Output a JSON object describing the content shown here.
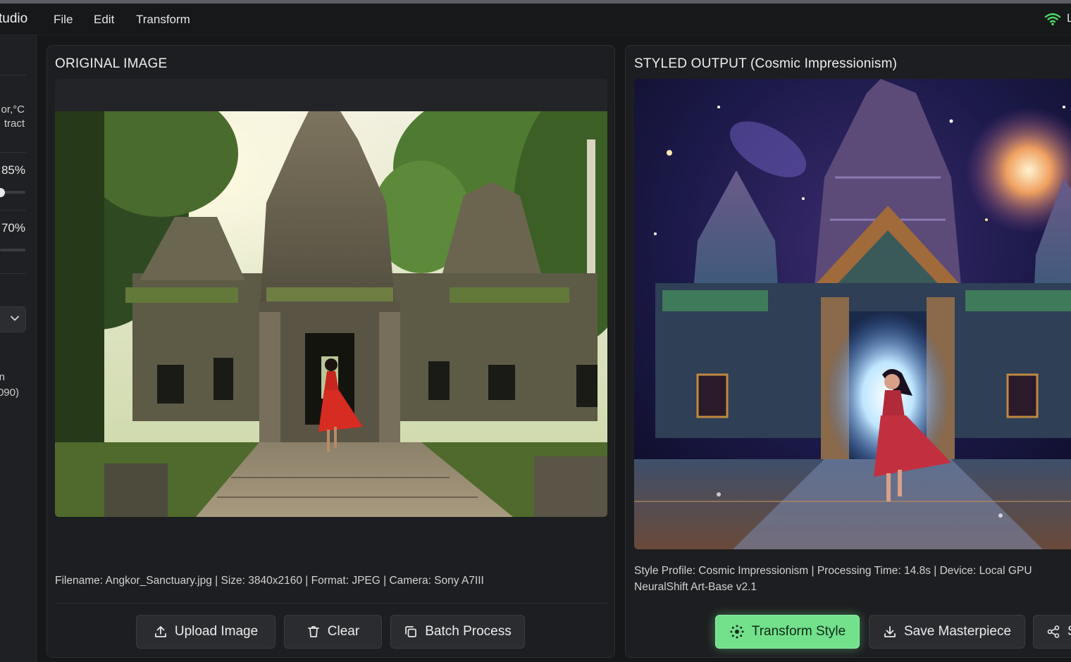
{
  "app": {
    "title": "tudio"
  },
  "menu": {
    "items": [
      "File",
      "Edit",
      "Transform"
    ]
  },
  "status": {
    "wifi_icon": "wifi-icon",
    "trailing_char": "L"
  },
  "sidebar": {
    "unit_line": "or,°C",
    "style_line": "tract",
    "slider1": {
      "value_label": "85%",
      "value": 0.85
    },
    "slider2": {
      "value_label": "70%",
      "value": 0.7
    },
    "dropdown_icon": "chevron-down-icon",
    "device_line1": "n",
    "device_line2": "090)"
  },
  "original_panel": {
    "title": "ORIGINAL IMAGE",
    "meta": "Filename: Angkor_Sanctuary.jpg | Size: 3840x2160 | Format: JPEG | Camera: Sony A7III",
    "buttons": [
      {
        "label": "Upload Image",
        "icon": "upload-icon"
      },
      {
        "label": "Clear",
        "icon": "trash-icon"
      },
      {
        "label": "Batch Process",
        "icon": "copy-icon"
      }
    ]
  },
  "styled_panel": {
    "title": "STYLED OUTPUT (Cosmic Impressionism)",
    "meta_line1": "Style Profile: Cosmic Impressionism | Processing Time: 14.8s | Device: Local GPU",
    "meta_line2": "NeuralShift Art-Base v2.1",
    "buttons": [
      {
        "label": "Transform Style",
        "icon": "sparkle-icon"
      },
      {
        "label": "Save Masterpiece",
        "icon": "download-icon"
      },
      {
        "label": "S",
        "icon": "share-icon"
      }
    ]
  },
  "colors": {
    "accent": "#73e08c",
    "background": "#161719",
    "panel": "#1d1e21",
    "wifi": "#4cd964"
  }
}
